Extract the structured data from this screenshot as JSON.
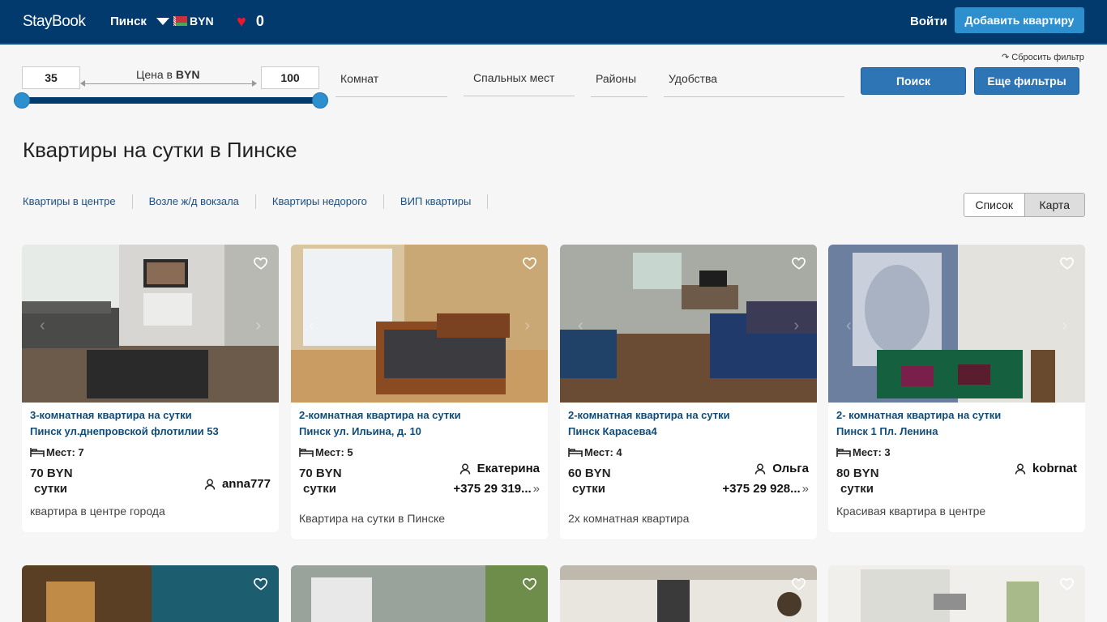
{
  "header": {
    "logo": "StayBook",
    "city": "Пинск",
    "currency": "BYN",
    "favorites_count": "0",
    "login": "Войти",
    "add_button": "Добавить квартиру"
  },
  "filter": {
    "reset": "↷ Сбросить фильтр",
    "price_min": "35",
    "price_max": "100",
    "price_label_prefix": "Цена в ",
    "price_label_currency": "BYN",
    "rooms": "Комнат",
    "sleeping": "Спальных мест",
    "districts": "Районы",
    "amenities": "Удобства",
    "search_button": "Поиск",
    "more_filters_button": "Еще фильтры"
  },
  "page_title": "Квартиры на сутки в Пинске",
  "quick_links": [
    "Квартиры в центре",
    "Возле ж/д вокзала",
    "Квартиры недорого",
    "ВИП квартиры"
  ],
  "view_toggle": {
    "list": "Список",
    "map": "Карта"
  },
  "colors": {
    "header": "#033a6e",
    "accent": "#2e8fcf",
    "button": "#2e75b6",
    "title": "#0f4c7a"
  },
  "listings": [
    {
      "title": "3-комнатная квартира на сутки",
      "address": "Пинск ул.днепровской флотилии 53",
      "places": "Мест: 7",
      "price": "70 BYN",
      "per": "сутки",
      "owner": "anna777",
      "phone": "",
      "description": "квартира в центре города"
    },
    {
      "title": "2-комнатная квартира на сутки",
      "address": "Пинск ул. Ильина, д. 10",
      "places": "Мест: 5",
      "price": "70 BYN",
      "per": "сутки",
      "owner": "Екатерина",
      "phone": "+375 29 319...",
      "description": "Квартира на сутки в Пинске"
    },
    {
      "title": "2-комнатная квартира на сутки",
      "address": "Пинск Карасева4",
      "places": "Мест: 4",
      "price": "60 BYN",
      "per": "сутки",
      "owner": "Ольга",
      "phone": "+375 29 928...",
      "description": "2х комнатная квартира"
    },
    {
      "title": "2- комнатная квартира на сутки",
      "address": "Пинск 1 Пл. Ленина",
      "places": "Мест: 3",
      "price": "80 BYN",
      "per": "сутки",
      "owner": "kobrnat",
      "phone": "",
      "description": "Красивая квартира в центре"
    }
  ]
}
